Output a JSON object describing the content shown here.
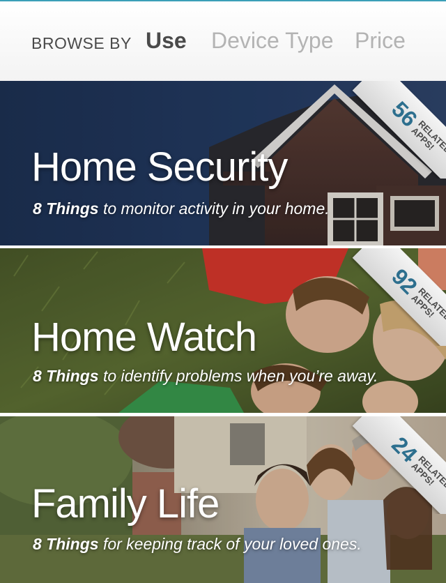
{
  "browse": {
    "label": "BROWSE BY",
    "tabs": [
      {
        "label": "Use",
        "active": true
      },
      {
        "label": "Device Type",
        "active": false
      },
      {
        "label": "Price",
        "active": false
      }
    ]
  },
  "cards": [
    {
      "title": "Home Security",
      "desc_bold": "8 Things",
      "desc_rest": " to monitor activity in your home.",
      "badge_count": "56",
      "badge_line1": "RELATED",
      "badge_line2": "APPS!"
    },
    {
      "title": "Home Watch",
      "desc_bold": "8 Things",
      "desc_rest": " to identify problems when you’re away.",
      "badge_count": "92",
      "badge_line1": "RELATED",
      "badge_line2": "APPS!"
    },
    {
      "title": "Family Life",
      "desc_bold": "8 Things",
      "desc_rest": " for keeping track of your loved ones.",
      "badge_count": "24",
      "badge_line1": "RELATED",
      "badge_line2": "APPS!"
    }
  ],
  "colors": {
    "accent_line": "#3a9fb8",
    "badge_number": "#2d6f8e",
    "security_bg": "#1d3150"
  }
}
